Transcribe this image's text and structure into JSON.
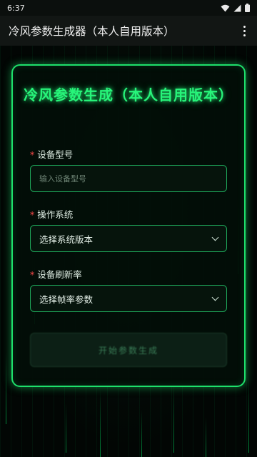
{
  "status_bar": {
    "time": "6:37"
  },
  "app_bar": {
    "title": "冷风参数生成器（本人自用版本）"
  },
  "form": {
    "title": "冷风参数生成（本人自用版本）",
    "required_mark": "*",
    "device_label": "设备型号",
    "device_placeholder": "输入设备型号",
    "os_label": "操作系统",
    "os_value": "选择系统版本",
    "refresh_label": "设备刷新率",
    "refresh_value": "选择帧率参数",
    "generate_button": "开始参数生成"
  },
  "colors": {
    "accent": "#27f57a",
    "border": "#1ee06b",
    "required": "#ff4b4b"
  },
  "icons": [
    "wifi-icon",
    "signal-icon",
    "battery-icon",
    "overflow-menu-icon",
    "chevron-down-icon"
  ]
}
